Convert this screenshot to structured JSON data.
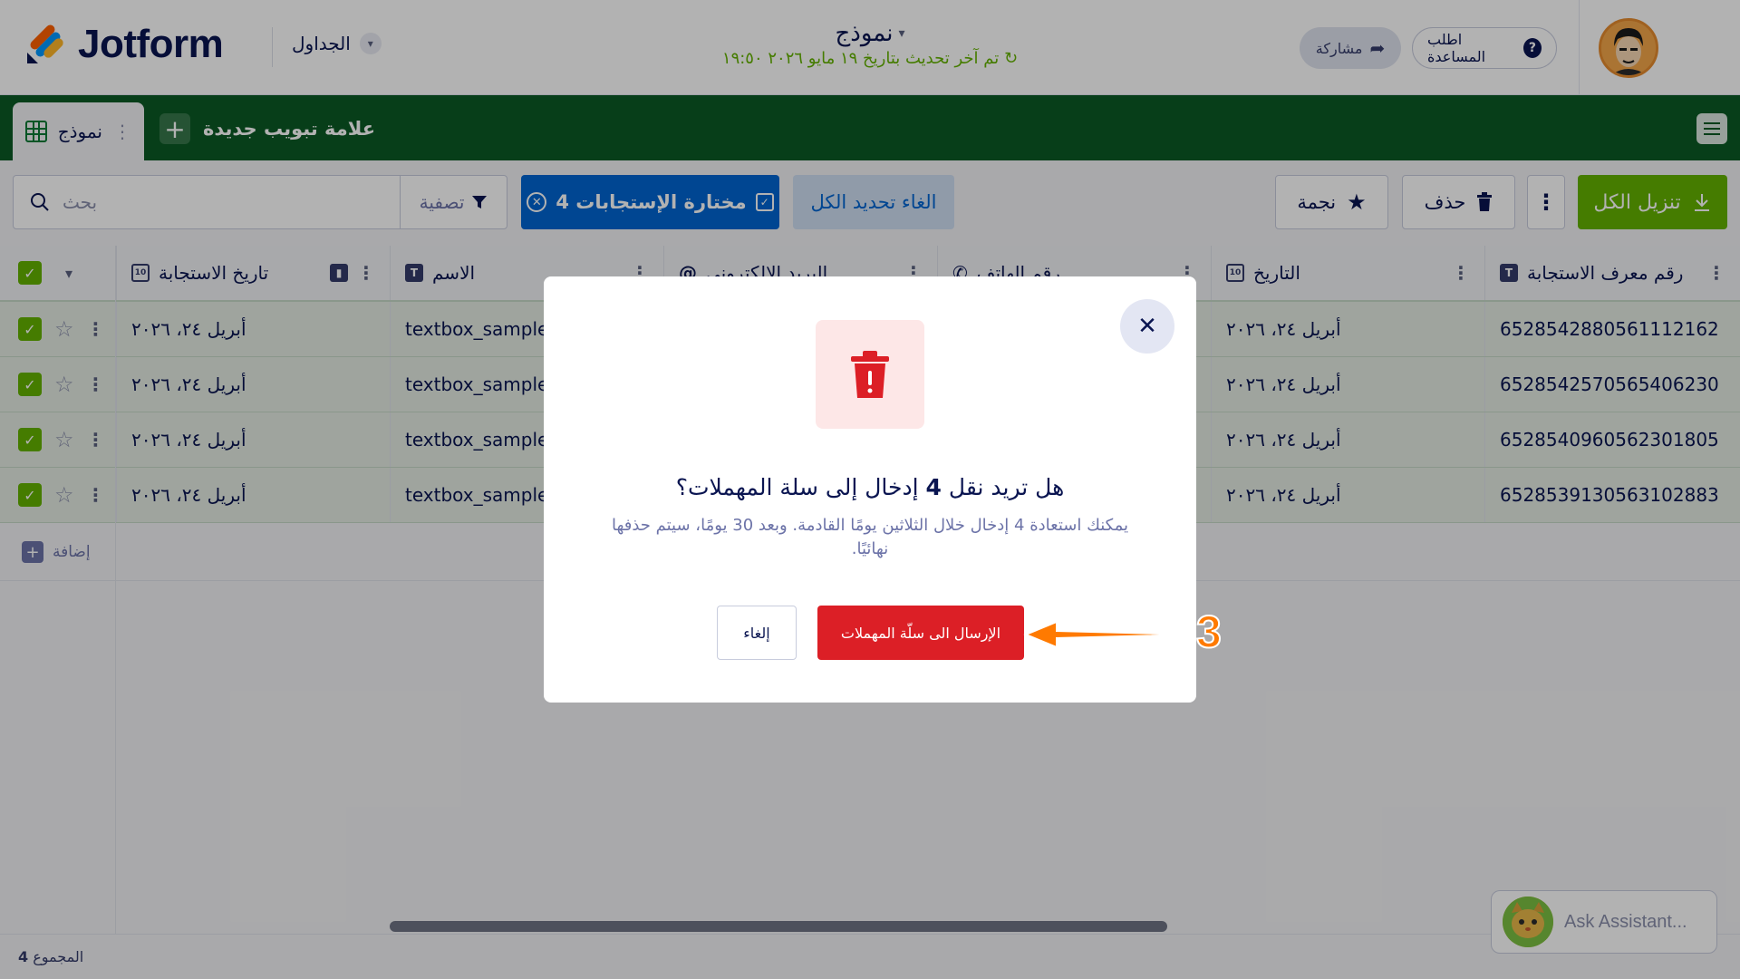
{
  "header": {
    "logo_text": "Jotform",
    "tables_label": "الجداول",
    "form_title": "نموذج",
    "last_updated": "تم آخر تحديث بتاريخ ١٩ مايو ٢٠٢٦ ١٩:٥٠",
    "share_label": "مشاركة",
    "help_label": "اطلب المساعدة"
  },
  "tabs": {
    "active_tab": "نموذج",
    "new_tab_label": "علامة تبويب جديدة"
  },
  "toolbar": {
    "search_placeholder": "بحث",
    "filter_label": "تصفية",
    "selected_label": "مختارة الإستجابات 4",
    "deselect_label": "الغاء تحديد الكل",
    "star_label": "نجمة",
    "delete_label": "حذف",
    "download_label": "تنزيل الكل"
  },
  "table": {
    "columns": [
      {
        "label": "رقم معرف الاستجابة"
      },
      {
        "label": "التاريخ"
      },
      {
        "label": "رقم الهاتف"
      },
      {
        "label": "البريد الإلكتروني"
      },
      {
        "label": "الاسم"
      },
      {
        "label": "تاريخ الاستجابة"
      }
    ],
    "rows": [
      {
        "id": "6528542880561112162",
        "date": "أبريل ٢٤، ٢٠٢٦",
        "name": "textbox_sample0",
        "response_date": "أبريل ٢٤، ٢٠٢٦"
      },
      {
        "id": "6528542570565406230",
        "date": "أبريل ٢٤، ٢٠٢٦",
        "name": "textbox_sample0",
        "response_date": "أبريل ٢٤، ٢٠٢٦"
      },
      {
        "id": "6528540960562301805",
        "date": "أبريل ٢٤، ٢٠٢٦",
        "name": "textbox_sample0",
        "response_date": "أبريل ٢٤، ٢٠٢٦"
      },
      {
        "id": "6528539130563102883",
        "date": "أبريل ٢٤، ٢٠٢٦",
        "name": "textbox_sample0",
        "response_date": "أبريل ٢٤، ٢٠٢٦"
      }
    ],
    "add_label": "إضافة"
  },
  "footer": {
    "total_label": "المجموع",
    "total_count": "4",
    "assistant_label": "Ask Assistant..."
  },
  "modal": {
    "question_prefix": "هل تريد نقل",
    "question_count": "4",
    "question_suffix": "إدخال إلى سلة المهملات؟",
    "description": "يمكنك استعادة 4 إدخال خلال الثلاثين يومًا القادمة. وبعد 30 يومًا، سيتم حذفها نهائيًا.",
    "cancel_label": "إلغاء",
    "confirm_label": "الإرسال الى سلّة المهملات"
  },
  "annotation": {
    "step_number": "3",
    "color": "#ff7a00"
  },
  "colors": {
    "brand_green": "#0b5a24",
    "accent_green": "#64b200",
    "selected_blue": "#0065d1",
    "danger_red": "#dc1f26"
  }
}
